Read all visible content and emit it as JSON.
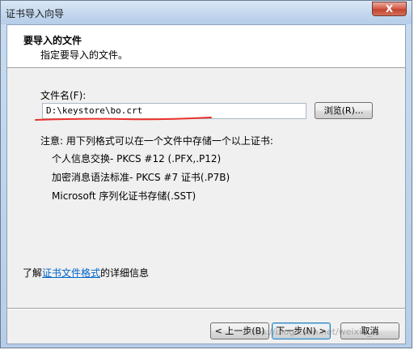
{
  "window": {
    "title": "证书导入向导",
    "close_label": "X"
  },
  "header": {
    "title": "要导入的文件",
    "subtitle": "指定要导入的文件。"
  },
  "file_field": {
    "label": "文件名(F):",
    "value": "D:\\keystore\\bo.crt",
    "browse_label": "浏览(R)..."
  },
  "note": {
    "heading": "注意: 用下列格式可以在一个文件中存储一个以上证书:",
    "formats": [
      "个人信息交换- PKCS #12 (.PFX,.P12)",
      "加密消息语法标准- PKCS #7 证书(.P7B)",
      "Microsoft 序列化证书存储(.SST)"
    ]
  },
  "learn_more": {
    "prefix": "了解",
    "link_text": "证书文件格式",
    "suffix": "的详细信息"
  },
  "footer": {
    "back_label": "< 上一步(B)",
    "next_label": "下一步(N) >",
    "cancel_label": "取消"
  },
  "watermark_text": "https://blog.csdn.net/weixin_..."
}
